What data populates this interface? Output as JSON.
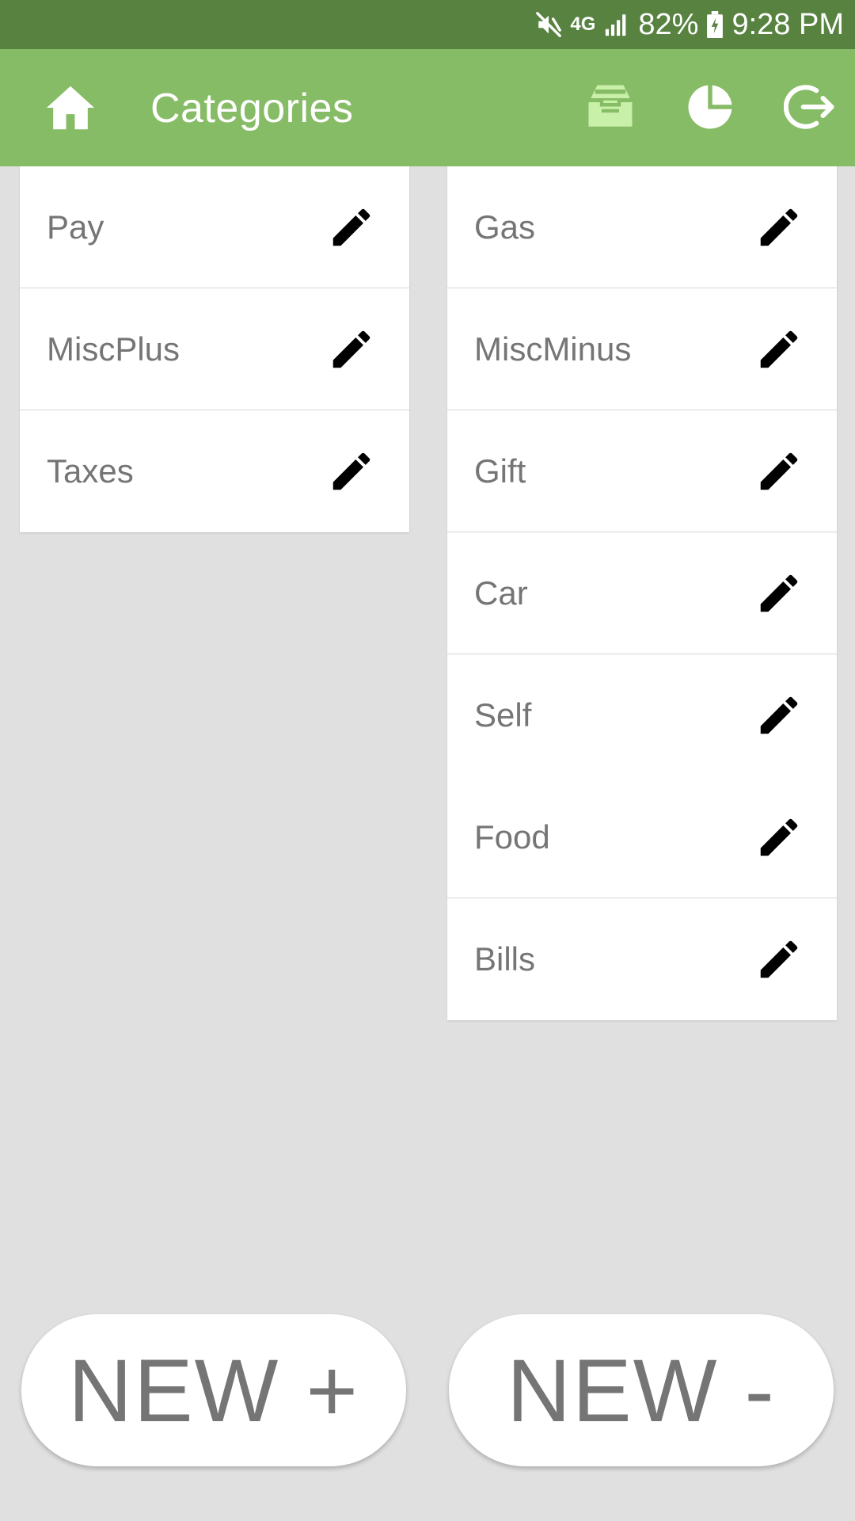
{
  "status_bar": {
    "network": "4G",
    "battery": "82%",
    "time": "9:28 PM",
    "icons": [
      "mute-icon",
      "network-4g-icon",
      "signal-icon",
      "battery-charging-icon"
    ]
  },
  "app_bar": {
    "title": "Categories",
    "icons": [
      "home-icon",
      "inbox-icon",
      "pie-chart-icon",
      "logout-icon"
    ],
    "colors": {
      "status_bar": "#578240",
      "app_bar": "#87bc66",
      "inbox_icon": "#c8f0a8"
    }
  },
  "income_categories": [
    {
      "label": "Pay"
    },
    {
      "label": "MiscPlus"
    },
    {
      "label": "Taxes"
    }
  ],
  "expense_categories": [
    {
      "label": "Gas"
    },
    {
      "label": "MiscMinus"
    },
    {
      "label": "Gift"
    },
    {
      "label": "Car"
    },
    {
      "label": "Self"
    },
    {
      "label": "Food"
    },
    {
      "label": "Bills"
    }
  ],
  "buttons": {
    "new_plus": "NEW +",
    "new_minus": "NEW -"
  }
}
